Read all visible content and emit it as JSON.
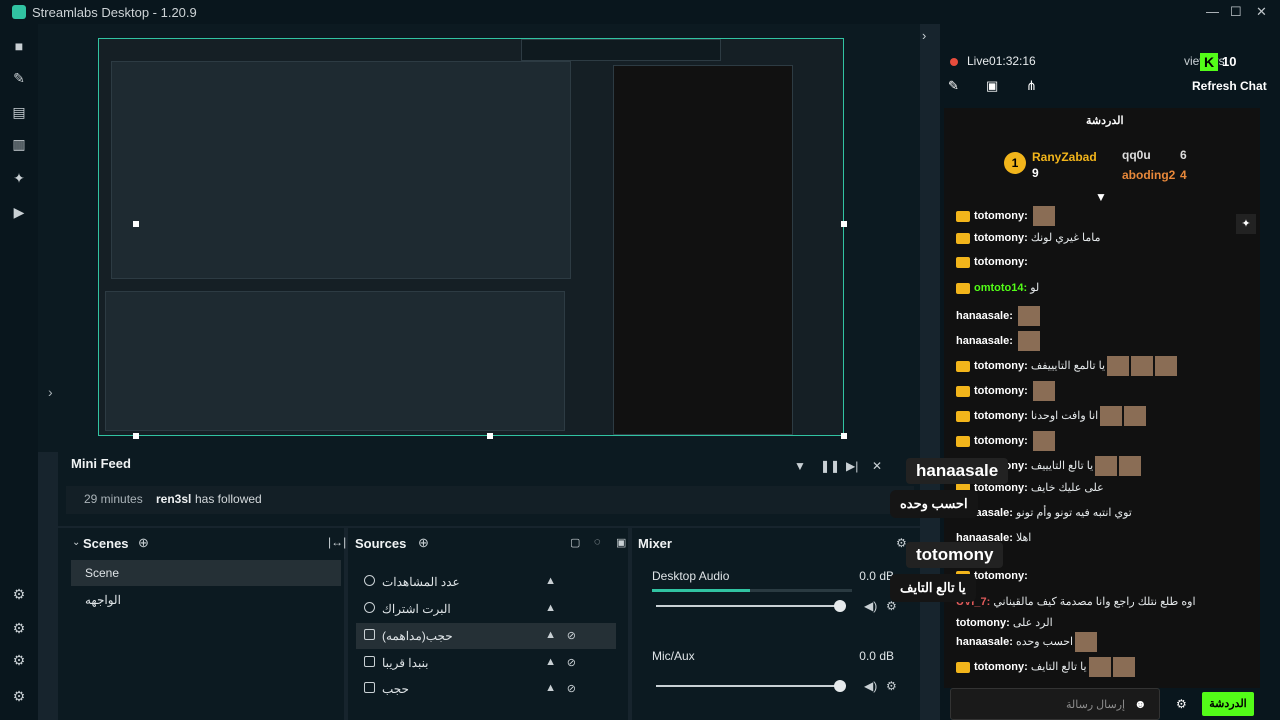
{
  "app": {
    "title": "Streamlabs Desktop - 1.20.9"
  },
  "sidebar": {
    "icons": [
      "studio-icon",
      "themes-icon",
      "store-icon",
      "layouts-icon",
      "highlighter-icon",
      "play-icon",
      "settings-icon"
    ]
  },
  "minifeed": {
    "title": "Mini Feed",
    "time": "29 minutes",
    "user": "ren3sl",
    "action": "has followed"
  },
  "scenes": {
    "title": "Scenes",
    "items": [
      "Scene",
      "الواجهه"
    ]
  },
  "sources": {
    "title": "Sources",
    "items": [
      "عدد المشاهدات",
      "البرت اشتراك",
      "حجب(مداهمه)",
      "بنبدا قريبا",
      "حجب"
    ]
  },
  "mixer": {
    "title": "Mixer",
    "rows": [
      {
        "name": "Desktop Audio",
        "db": "0.0 dB",
        "level": 0.49
      },
      {
        "name": "Mic/Aux",
        "db": "0.0 dB",
        "level": 0
      }
    ]
  },
  "chat": {
    "live": "Live01:32:16",
    "viewers": "viewers",
    "viewer_count": "10",
    "refresh": "Refresh Chat",
    "header": "الدردشة",
    "leaderboard": [
      {
        "rank": "1",
        "name": "RanyZabad",
        "count": "9"
      },
      {
        "rank": "",
        "name": "qq0u",
        "count": "6"
      },
      {
        "rank": "",
        "name": "aboding2",
        "count": "4"
      }
    ],
    "messages": [
      {
        "user": "totomony:",
        "text": ""
      },
      {
        "user": "totomony:",
        "text": "ماما غيري لونك"
      },
      {
        "user": "totomony:",
        "text": ""
      },
      {
        "user": "omtoto14:",
        "text": "لو"
      },
      {
        "user": "hanaasale:",
        "text": ""
      },
      {
        "user": "hanaasale:",
        "text": ""
      },
      {
        "user": "totomony:",
        "text": "يا تالمع التايييفف"
      },
      {
        "user": "totomony:",
        "text": ""
      },
      {
        "user": "totomony:",
        "text": "انا وافت اوحدنا"
      },
      {
        "user": "totomony:",
        "text": ""
      },
      {
        "user": "totomony:",
        "text": "يا تالع التايييف"
      },
      {
        "user": "totomony:",
        "text": "على عليك خايف"
      },
      {
        "user": "hanaasale:",
        "text": "توي انتبه فيه تونو وأم تونو"
      },
      {
        "user": "hanaasale:",
        "text": "اهلا"
      },
      {
        "user": "totomony:",
        "text": ""
      },
      {
        "user": "UVI_7:",
        "text": "اوه طلع نتلك راجع وانا مصدمة كيف مالقيناني"
      },
      {
        "user": "totomony:",
        "text": "الرد على"
      },
      {
        "user": "hanaasale:",
        "text": "احسب وحده"
      },
      {
        "user": "totomony:",
        "text": "يا تالع التايف"
      }
    ],
    "overlay": [
      {
        "name": "hanaasale",
        "text": "احسب وحده"
      },
      {
        "name": "totomony",
        "text": "يا تالع التايف"
      }
    ],
    "input_placeholder": "إرسال رسالة",
    "send": "الدردشة"
  }
}
